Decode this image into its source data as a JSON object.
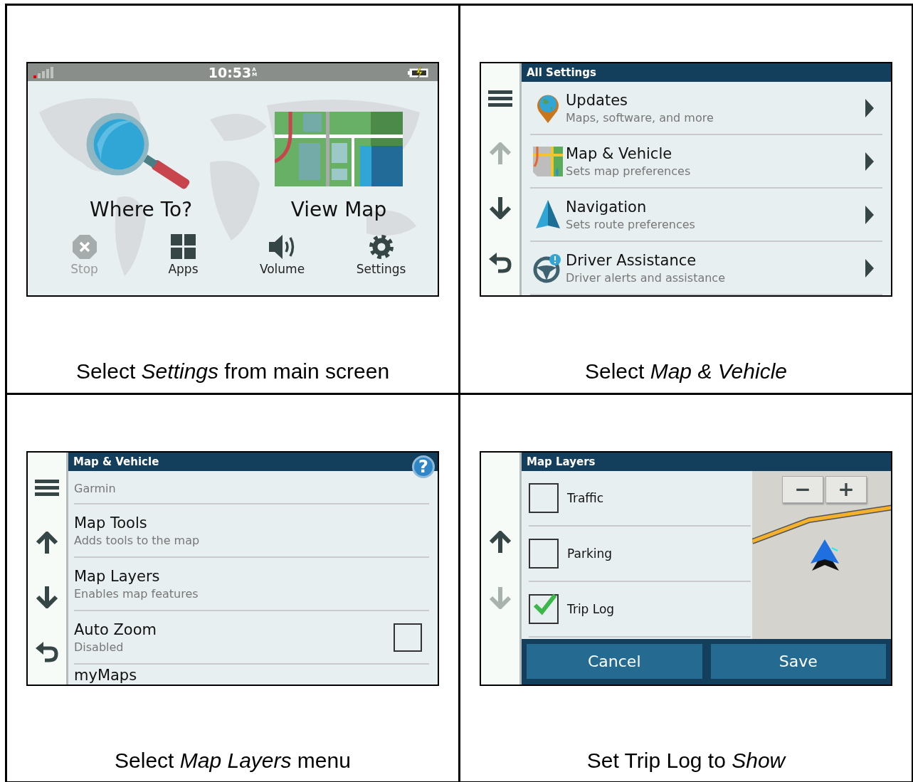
{
  "panels": [
    {
      "kind": "home",
      "caption": "Select *Settings* from main screen",
      "status": {
        "time": "10:53",
        "meridiem": "AM"
      },
      "tiles": [
        {
          "kind": "search",
          "label": "Where To?"
        },
        {
          "kind": "map",
          "label": "View Map"
        }
      ],
      "bar": [
        {
          "kind": "stop",
          "label": "Stop",
          "disabled": true
        },
        {
          "kind": "apps",
          "label": "Apps",
          "disabled": false
        },
        {
          "kind": "volume",
          "label": "Volume",
          "disabled": false
        },
        {
          "kind": "settings",
          "label": "Settings",
          "disabled": false
        }
      ]
    },
    {
      "kind": "list",
      "caption": "Select *Map & Vehicle*",
      "title": "All Settings",
      "nav": [
        {
          "kind": "menu",
          "disabled": false
        },
        {
          "kind": "up",
          "disabled": true
        },
        {
          "kind": "down",
          "disabled": false
        },
        {
          "kind": "back",
          "disabled": false
        }
      ],
      "items": [
        {
          "kind": "pin",
          "title": "Updates",
          "subtitle": "Maps, software, and more"
        },
        {
          "kind": "map",
          "title": "Map & Vehicle",
          "subtitle": "Sets map preferences"
        },
        {
          "kind": "navigation",
          "title": "Navigation",
          "subtitle": "Sets route preferences"
        },
        {
          "kind": "wheel",
          "title": "Driver Assistance",
          "subtitle": "Driver alerts and assistance"
        }
      ]
    },
    {
      "kind": "settings",
      "caption": "Select *Map Layers* menu",
      "title": "Map & Vehicle",
      "help": "?",
      "nav": [
        {
          "kind": "menu",
          "disabled": false
        },
        {
          "kind": "up",
          "disabled": false
        },
        {
          "kind": "down",
          "disabled": false
        },
        {
          "kind": "back",
          "disabled": false
        }
      ],
      "items": [
        {
          "subtitle": "Garmin"
        },
        {
          "title": "Map Tools",
          "subtitle": "Adds tools to the map"
        },
        {
          "title": "Map Layers",
          "subtitle": "Enables map features"
        },
        {
          "title": "Auto Zoom",
          "subtitle": "Disabled",
          "checked": false
        },
        {
          "title": "myMaps"
        }
      ]
    },
    {
      "kind": "layers",
      "caption": "Set Trip Log to *Show*",
      "title": "Map Layers",
      "nav": [
        {
          "kind": "up",
          "disabled": false
        },
        {
          "kind": "down",
          "disabled": true
        }
      ],
      "layers": [
        {
          "label": "Traffic",
          "checked": false
        },
        {
          "label": "Parking",
          "checked": false
        },
        {
          "label": "Trip Log",
          "checked": true
        }
      ],
      "zoom": [
        "−",
        "+"
      ],
      "buttons": [
        "Cancel",
        "Save"
      ]
    }
  ]
}
